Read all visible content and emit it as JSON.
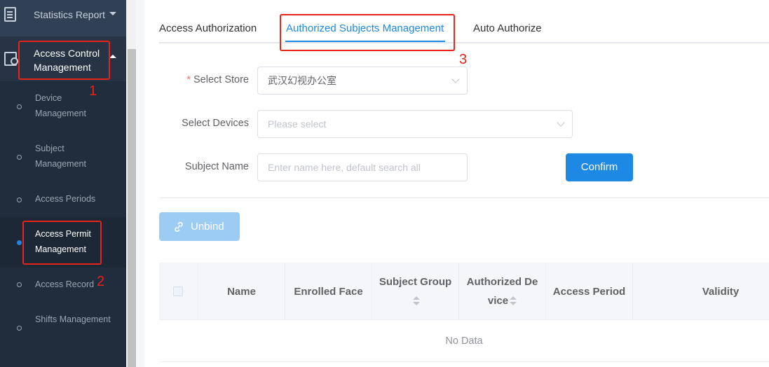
{
  "sidebar": {
    "statistics_report": "Statistics Report",
    "access_control": "Access Control Management",
    "items": [
      {
        "label": "Device Management"
      },
      {
        "label": "Subject Management"
      },
      {
        "label": "Access Periods"
      },
      {
        "label": "Access Permit Management"
      },
      {
        "label": "Access Record"
      },
      {
        "label": "Shifts Management"
      }
    ]
  },
  "tabs": [
    {
      "label": "Access Authorization"
    },
    {
      "label": "Authorized Subjects Management"
    },
    {
      "label": "Auto Authorize"
    }
  ],
  "annotations": [
    "1",
    "2",
    "3"
  ],
  "form": {
    "store": {
      "label": "Select Store",
      "value": "武汉幻视办公室"
    },
    "devices": {
      "label": "Select Devices",
      "placeholder": "Please select"
    },
    "subject_name": {
      "label": "Subject Name",
      "placeholder": "Enter name here, default search all"
    },
    "confirm_label": "Confirm"
  },
  "toolbar": {
    "unbind_label": "Unbind"
  },
  "table": {
    "columns": [
      "Name",
      "Enrolled Face",
      "Subject Group",
      "Authorized De",
      "vice",
      "Access Period",
      "Validity"
    ],
    "empty_text": "No Data"
  },
  "colors": {
    "accent": "#1e88e5",
    "annotation": "#e8231a",
    "sidebar_bg": "#2d3a4b"
  }
}
